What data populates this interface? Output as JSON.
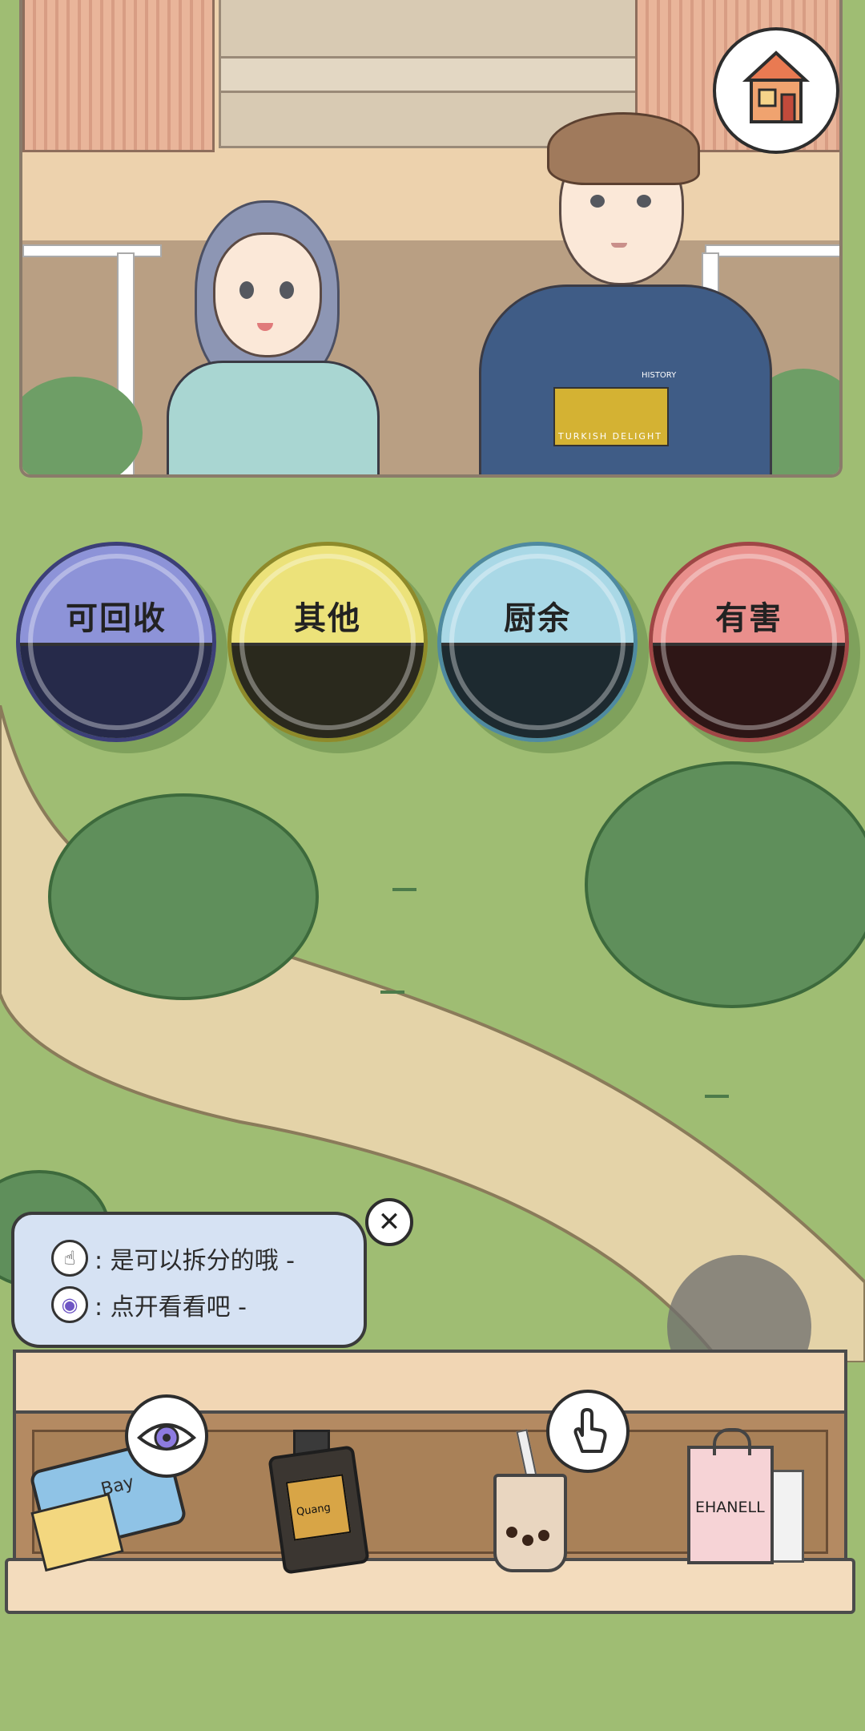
{
  "home_button": {
    "icon": "house-icon"
  },
  "scene": {
    "girl_shirt_color": "#a9d6d2",
    "boy_shirt_color": "#3f5c86",
    "boy_shirt_print": "TURKISH DELIGHT",
    "boy_shirt_small": "HISTORY"
  },
  "bins": [
    {
      "label": "可回收",
      "top_color": "#8d93d8",
      "bottom_color": "#262a4a",
      "border": "#3c3f78"
    },
    {
      "label": "其他",
      "top_color": "#ece27a",
      "bottom_color": "#2a291d",
      "border": "#8e8a2a"
    },
    {
      "label": "厨余",
      "top_color": "#a9d8e6",
      "bottom_color": "#1d2a30",
      "border": "#4f8aa0"
    },
    {
      "label": "有害",
      "top_color": "#e98f8c",
      "bottom_color": "#2e1616",
      "border": "#a04646"
    }
  ],
  "hint": {
    "line1": ": 是可以拆分的哦 -",
    "line2": ": 点开看看吧 -",
    "line1_icon": "tap-hand-icon",
    "line2_icon": "eye-icon",
    "close_label": "✕"
  },
  "shelf": {
    "items": [
      {
        "name": "bag-item",
        "text": "Bay"
      },
      {
        "name": "lotion-bottle-item",
        "text": "Quang"
      },
      {
        "name": "bubble-tea-item",
        "text": ""
      },
      {
        "name": "shopping-bag-item",
        "text": "EHANELL"
      }
    ]
  }
}
